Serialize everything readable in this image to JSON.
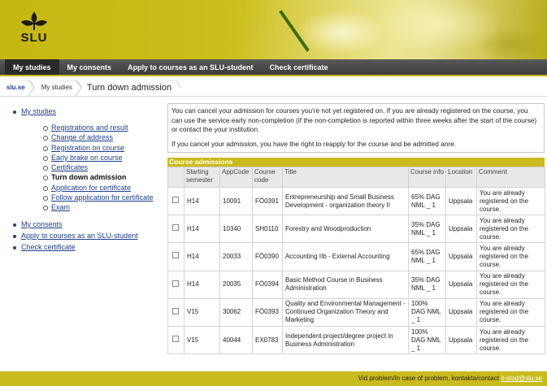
{
  "header": {
    "logo_text": "SLU"
  },
  "nav": {
    "tabs": [
      "My studies",
      "My consents",
      "Apply to courses as an SLU-student",
      "Check certificate"
    ]
  },
  "breadcrumb": {
    "home": "slu.se",
    "section": "My studies",
    "current": "Turn down admission"
  },
  "sidebar": {
    "my_studies": "My studies",
    "sub_items": [
      "Registrations and result",
      "Change of address",
      "Registration on course",
      "Early brake on course",
      "Certificates",
      "Turn down admission",
      "Application for certificate",
      "Follow application for certificate",
      "Exam"
    ],
    "other_items": [
      "My consents",
      "Apply to courses as an SLU-student",
      "Check certificate"
    ]
  },
  "info": {
    "p1": "You can cancel your admission for courses you're not yet registered on. If you are already registered on the course, you can use the service early non-completion (if the non-completion is reported within three weeks after the start of the course) or contact the your institution.",
    "p2": "If you cancel your admission, you have the right to reapply for the course and be admitted anre."
  },
  "table": {
    "caption": "Course admissions",
    "headers": [
      "",
      "Starting semester",
      "AppCode",
      "Course code",
      "Title",
      "Course info",
      "Location",
      "Comment"
    ],
    "rows": [
      [
        "H14",
        "10091",
        "FÖ0391",
        "Entrepreneurship and Small Business Development - organization theory II",
        "65% DAG NML _ 1",
        "Uppsala",
        "You are already registered on the course."
      ],
      [
        "H14",
        "10340",
        "SH0110",
        "Forestry and Woodproduction",
        "35% DAG NML _ 1",
        "Uppsala",
        "You are already registered on the course."
      ],
      [
        "H14",
        "20033",
        "FÖ0390",
        "Accounting IIb - External Accounting",
        "65% DAG NML _ 1",
        "Uppsala",
        "You are already registered on the course."
      ],
      [
        "H14",
        "20035",
        "FÖ0394",
        "Basic Method Course in Business Administration",
        "35% DAG NML _ 1",
        "Uppsala",
        "You are already registered on the course."
      ],
      [
        "V15",
        "30062",
        "FÖ0393",
        "Quality and Environmental Management - Continued Organization Theory and Marketing",
        "100% DAG NML _ 1",
        "Uppsala",
        "You are already registered on the course."
      ],
      [
        "V15",
        "40044",
        "EX0783",
        "Independent project/degree project in Business Administration",
        "100% DAG NML _ 1",
        "Uppsala",
        "You are already registered on the course."
      ]
    ]
  },
  "footer": {
    "text": "Vid problem/In case of problem, kontakta/contact ",
    "email": "it-stod@slu.se"
  },
  "colors": {
    "brand": "#c9bb1d",
    "nav_bg": "#3b3b3b",
    "link": "#1d3f8a"
  }
}
